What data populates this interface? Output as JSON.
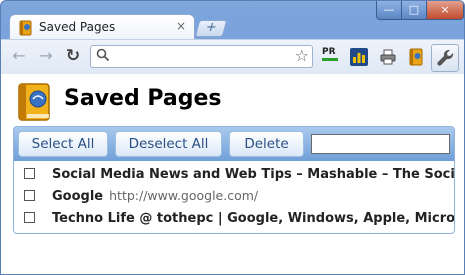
{
  "tab": {
    "title": "Saved Pages",
    "close": "×",
    "new_tab": "+"
  },
  "window_controls": {
    "minimize": "—",
    "maximize": "□",
    "close": "×"
  },
  "toolbar": {
    "omnibox_value": "",
    "pr_label": "PR",
    "icons": [
      "back-arrow-icon",
      "forward-arrow-icon",
      "reload-icon",
      "search-icon",
      "star-icon",
      "pagerank-icon",
      "chart-icon",
      "print-icon",
      "saved-pages-book-icon",
      "wrench-icon"
    ]
  },
  "page": {
    "title": "Saved Pages"
  },
  "actions": {
    "select_all": "Select All",
    "deselect_all": "Deselect All",
    "delete": "Delete",
    "filter_value": ""
  },
  "saved_pages": [
    {
      "title": "Social Media News and Web Tips – Mashable – The Social Media Guide",
      "url": ""
    },
    {
      "title": "Google",
      "url": "http://www.google.com/"
    },
    {
      "title": "Techno Life @ tothepc | Google, Windows, Apple, Microsoft",
      "url": ""
    }
  ],
  "colors": {
    "window_frame": "#7ea6dd",
    "panel_bar": "#8fb8e6",
    "button_text": "#2a4f86",
    "close_button": "#c24a2e"
  }
}
